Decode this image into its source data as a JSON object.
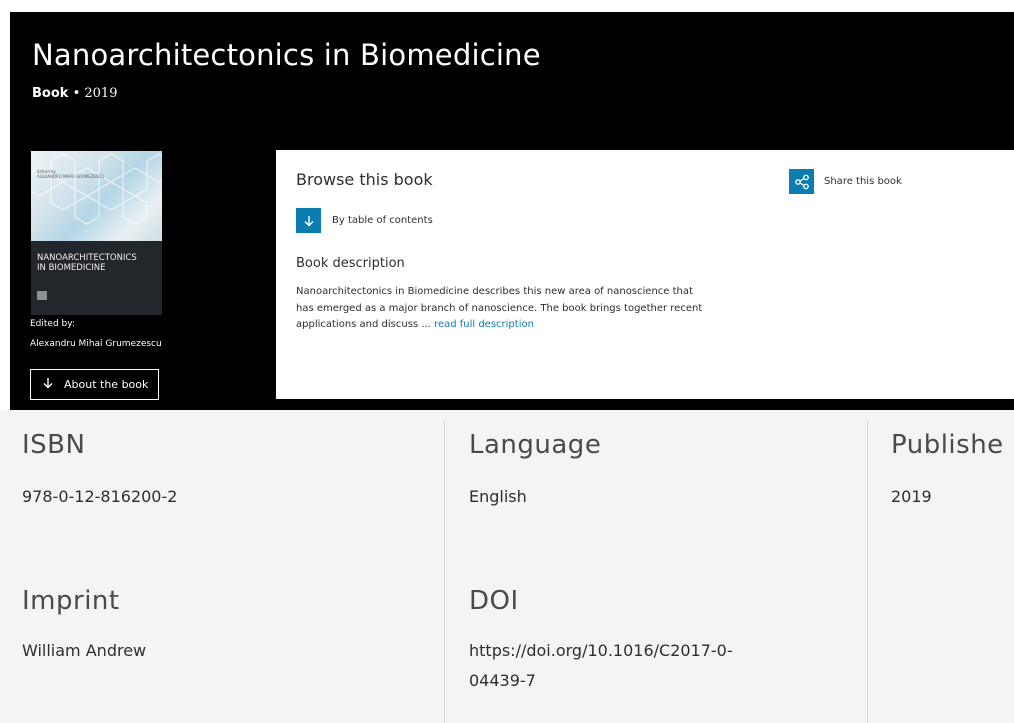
{
  "header": {
    "title": "Nanoarchitectonics in Biomedicine",
    "kind": "Book",
    "separator": "•",
    "year": "2019"
  },
  "cover": {
    "editor_small": "Edited by",
    "editor_small_name": "ALEXANDRU MIHAI GRUMEZESCU",
    "title_line1": "NANOARCHITECTONICS",
    "title_line2": "IN BIOMEDICINE"
  },
  "editor": {
    "label": "Edited by:",
    "name": "Alexandru Mihai Grumezescu"
  },
  "about_button": {
    "label": "About the book",
    "icon": "arrow-down-icon"
  },
  "browse": {
    "title": "Browse this book",
    "toc_label": "By table of contents",
    "toc_icon": "arrow-down-icon",
    "share_label": "Share this book",
    "share_icon": "share-icon"
  },
  "description": {
    "title": "Book description",
    "line1": "Nanoarchitectonics in Biomedicine describes this new area of nanoscience that",
    "line2": "has emerged as a major branch of nanoscience. The book brings together recent",
    "line3": "applications and discuss ...",
    "read_more": "read full description"
  },
  "details": {
    "isbn_label": "ISBN",
    "isbn_value": "978-0-12-816200-2",
    "language_label": "Language",
    "language_value": "English",
    "published_label": "Publishe",
    "published_value": "2019",
    "imprint_label": "Imprint",
    "imprint_value": "William Andrew",
    "doi_label": "DOI",
    "doi_value_line1": "https://doi.org/10.1016/C2017-0-",
    "doi_value_line2": "04439-7"
  },
  "colors": {
    "hero_bg": "#000000",
    "accent": "#0c7db1",
    "details_bg": "#f4f4f4"
  }
}
